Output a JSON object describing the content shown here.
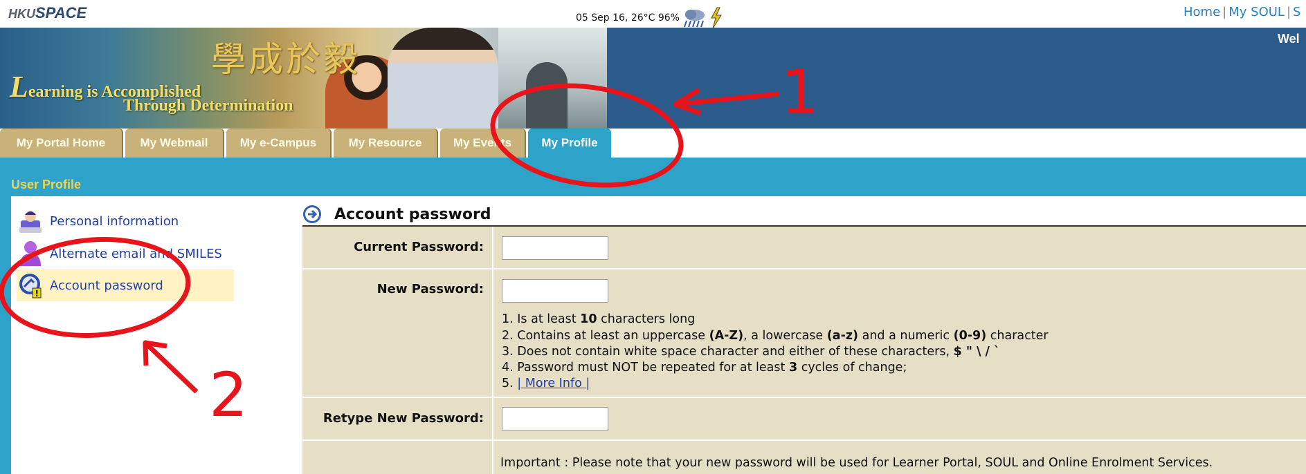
{
  "header": {
    "logo_prefix": "HKU",
    "logo_main": "SPACE",
    "weather": "05 Sep 16, 26°C 96%",
    "links": [
      "Home",
      "My SOUL",
      "S"
    ],
    "welcome": "Wel"
  },
  "banner": {
    "slogan_cn": "學成於毅",
    "slogan_en_initial": "L",
    "slogan_en_line1": "earning is Accomplished",
    "slogan_en_line2": "Through Determination"
  },
  "tabs": [
    {
      "label": "My Portal Home",
      "active": false
    },
    {
      "label": "My Webmail",
      "active": false
    },
    {
      "label": "My e-Campus",
      "active": false
    },
    {
      "label": "My Resource",
      "active": false
    },
    {
      "label": "My Events",
      "active": false
    },
    {
      "label": "My Profile",
      "active": true
    }
  ],
  "section_title": "User Profile",
  "sidebar": {
    "items": [
      {
        "label": "Personal information",
        "icon": "person-icon",
        "active": false
      },
      {
        "label": "Alternate email and SMILES",
        "icon": "user-email-icon",
        "active": false
      },
      {
        "label": "Account password",
        "icon": "password-key-icon",
        "active": true
      }
    ]
  },
  "content": {
    "title": "Account password",
    "current_password_label": "Current Password:",
    "new_password_label": "New Password:",
    "retype_label": "Retype New Password:",
    "current_password_value": "",
    "new_password_value": "",
    "retype_value": "",
    "rules": {
      "r1_a": "1. Is at least ",
      "r1_b": "10",
      "r1_c": " characters long",
      "r2_a": "2. Contains at least an uppercase ",
      "r2_b": "(A-Z)",
      "r2_c": ", a lowercase ",
      "r2_d": "(a-z)",
      "r2_e": " and a numeric ",
      "r2_f": "(0-9)",
      "r2_g": " character",
      "r3_a": "3. Does not contain white space character and either of these characters, ",
      "r3_b": "$ \" \\ / `",
      "r4_a": "4. Password must NOT be repeated for at least ",
      "r4_b": "3",
      "r4_c": " cycles of change;",
      "r5_a": "5. ",
      "r5_link": "| More Info |"
    },
    "important_note": "Important : Please note that your new password will be used for Learner Portal, SOUL and Online Enrolment Services."
  },
  "annotations": {
    "label_1": "1",
    "label_2": "2",
    "color": "#e8141b"
  }
}
